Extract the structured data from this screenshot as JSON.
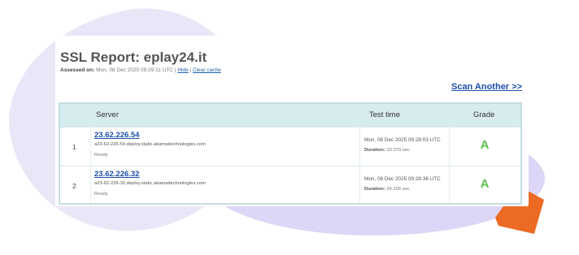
{
  "report": {
    "title": "SSL Report: eplay24.it",
    "assessed_label": "Assessed on:",
    "assessed_date": "Mon, 08 Dec 2025 09:29:11 UTC",
    "hide_link": "Hide",
    "clear_cache_link": "Clear cache",
    "scan_another": "Scan Another >>"
  },
  "table": {
    "headers": {
      "server": "Server",
      "test_time": "Test time",
      "grade": "Grade"
    },
    "rows": [
      {
        "num": "1",
        "ip": "23.62.226.54",
        "host": "a23-62-226-54.deploy.static.akamaitechnologies.com",
        "status": "Ready",
        "test_time": "Mon, 08 Dec 2025 09:28:03 UTC",
        "duration_label": "Duration:",
        "duration": "33.379 sec",
        "grade": "A"
      },
      {
        "num": "2",
        "ip": "23.62.226.32",
        "host": "a23-62-226-32.deploy.static.akamaitechnologies.com",
        "status": "Ready",
        "test_time": "Mon, 08 Dec 2025 09:28:36 UTC",
        "duration_label": "Duration:",
        "duration": "34.206 sec",
        "grade": "A"
      }
    ]
  },
  "colors": {
    "accent_link": "#1c4fa8",
    "grade_a": "#5cc24e",
    "table_header_bg": "#d6ecee",
    "decor_orange": "#ec6a24",
    "decor_lavender": "#ddd6f6"
  }
}
